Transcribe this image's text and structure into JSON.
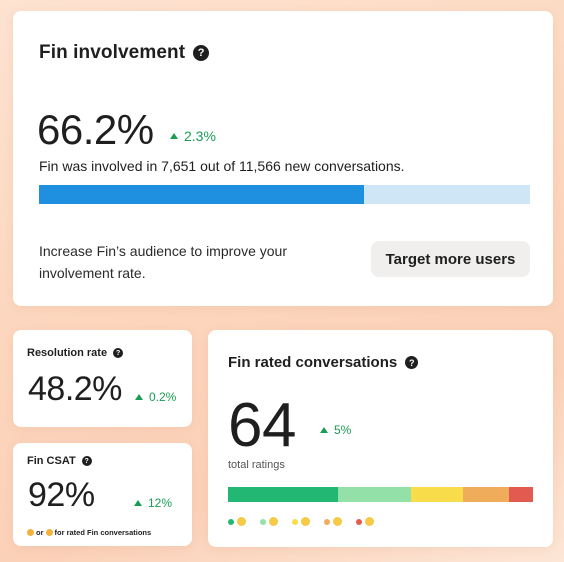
{
  "fin_involvement": {
    "title": "Fin involvement",
    "help_icon": "question-circle-icon",
    "value": "66.2%",
    "delta": "2.3%",
    "description": "Fin was involved in 7,651 out of 11,566 new conversations.",
    "involved": 7651,
    "total": 11566,
    "hint": "Increase Fin’s audience to improve your involvement rate.",
    "button_label": "Target more users",
    "bar_colors": {
      "fill": "#1f8fe0",
      "track": "#cfe6f7"
    }
  },
  "resolution_rate": {
    "title": "Resolution rate",
    "value": "48.2%",
    "delta": "0.2%"
  },
  "fin_csat": {
    "title": "Fin CSAT",
    "value": "92%",
    "delta": "12%",
    "footnote_or": "or",
    "footnote_text": "for rated Fin conversations"
  },
  "fin_rated": {
    "title": "Fin rated conversations",
    "value": "64",
    "delta": "5%",
    "subtitle": "total ratings",
    "segments": [
      {
        "name": "amazing",
        "fraction": 0.36,
        "color": "#22b873",
        "face": "😍"
      },
      {
        "name": "great",
        "fraction": 0.24,
        "color": "#93e0a8",
        "face": "😃"
      },
      {
        "name": "ok",
        "fraction": 0.17,
        "color": "#f8dc4a",
        "face": "😐"
      },
      {
        "name": "bad",
        "fraction": 0.15,
        "color": "#efac5a",
        "face": "🙁"
      },
      {
        "name": "terrible",
        "fraction": 0.08,
        "color": "#e35a50",
        "face": "😠"
      }
    ]
  },
  "colors": {
    "positive": "#1a9c55",
    "text": "#1f1f1f"
  }
}
